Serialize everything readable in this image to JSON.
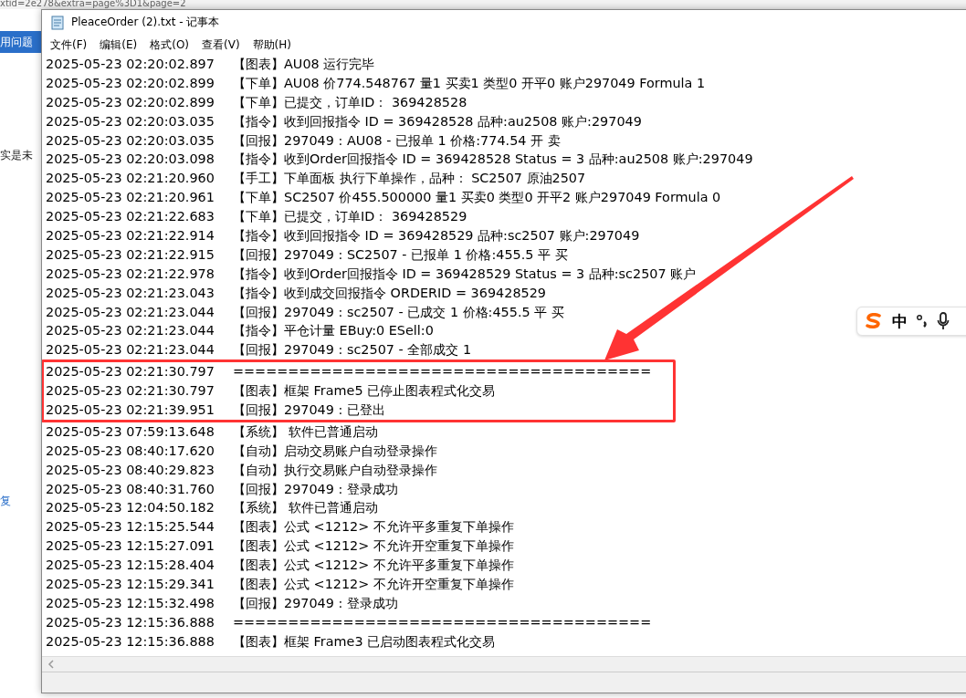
{
  "background": {
    "url": "xtid=2e278&extra=page%3D1&page=2",
    "tab": "用问题",
    "snippets": [
      "实是未",
      "复"
    ]
  },
  "window": {
    "title": "PleaceOrder (2).txt - 记事本"
  },
  "menu": [
    "文件(F)",
    "编辑(E)",
    "格式(O)",
    "查看(V)",
    "帮助(H)"
  ],
  "lines": [
    {
      "time": "2025-05-23 02:20:02.897",
      "message": "【图表】AU08 运行完毕",
      "highlighted": false
    },
    {
      "time": "2025-05-23 02:20:02.899",
      "message": "【下单】AU08 价774.548767 量1 买卖1 类型0 开平0 账户297049 Formula 1",
      "highlighted": false
    },
    {
      "time": "2025-05-23 02:20:02.899",
      "message": "【下单】已提交，订单ID： 369428528",
      "highlighted": false
    },
    {
      "time": "2025-05-23 02:20:03.035",
      "message": "【指令】收到回报指令 ID = 369428528 品种:au2508 账户:297049",
      "highlighted": false
    },
    {
      "time": "2025-05-23 02:20:03.035",
      "message": "【回报】297049 : AU08 - 已报单 1 价格:774.54 开 卖",
      "highlighted": false
    },
    {
      "time": "2025-05-23 02:20:03.098",
      "message": "【指令】收到Order回报指令 ID = 369428528 Status = 3 品种:au2508 账户:297049",
      "highlighted": false
    },
    {
      "time": "2025-05-23 02:21:20.960",
      "message": "【手工】下单面板 执行下单操作，品种： SC2507 原油2507",
      "highlighted": false
    },
    {
      "time": "2025-05-23 02:21:20.961",
      "message": "【下单】SC2507 价455.500000 量1 买卖0 类型0 开平2 账户297049 Formula 0",
      "highlighted": false
    },
    {
      "time": "2025-05-23 02:21:22.683",
      "message": "【下单】已提交，订单ID： 369428529",
      "highlighted": false
    },
    {
      "time": "2025-05-23 02:21:22.914",
      "message": "【指令】收到回报指令 ID = 369428529 品种:sc2507 账户:297049",
      "highlighted": false
    },
    {
      "time": "2025-05-23 02:21:22.915",
      "message": "【回报】297049 : SC2507 - 已报单 1 价格:455.5 平 买",
      "highlighted": false
    },
    {
      "time": "2025-05-23 02:21:22.978",
      "message": "【指令】收到Order回报指令 ID = 369428529 Status = 3 品种:sc2507 账户",
      "highlighted": false
    },
    {
      "time": "2025-05-23 02:21:23.043",
      "message": "【指令】收到成交回报指令 ORDERID = 369428529",
      "highlighted": false
    },
    {
      "time": "2025-05-23 02:21:23.044",
      "message": "【回报】297049 : sc2507 - 已成交 1 价格:455.5 平 买",
      "highlighted": false
    },
    {
      "time": "2025-05-23 02:21:23.044",
      "message": "【指令】平仓计量 EBuy:0 ESell:0",
      "highlighted": false
    },
    {
      "time": "2025-05-23 02:21:23.044",
      "message": "【回报】297049 : sc2507 - 全部成交 1",
      "highlighted": false
    },
    {
      "time": "2025-05-23 02:21:30.797",
      "message": "======================================",
      "highlighted": true
    },
    {
      "time": "2025-05-23 02:21:30.797",
      "message": "【图表】框架 Frame5 已停止图表程式化交易",
      "highlighted": true
    },
    {
      "time": "2025-05-23 02:21:39.951",
      "message": "【回报】297049 : 已登出",
      "highlighted": true
    },
    {
      "time": "2025-05-23 07:59:13.648",
      "message": "【系统】 软件已普通启动",
      "highlighted": false
    },
    {
      "time": "2025-05-23 08:40:17.620",
      "message": "【自动】启动交易账户自动登录操作",
      "highlighted": false
    },
    {
      "time": "2025-05-23 08:40:29.823",
      "message": "【自动】执行交易账户自动登录操作",
      "highlighted": false
    },
    {
      "time": "2025-05-23 08:40:31.760",
      "message": "【回报】297049 : 登录成功",
      "highlighted": false
    },
    {
      "time": "2025-05-23 12:04:50.182",
      "message": "【系统】 软件已普通启动",
      "highlighted": false
    },
    {
      "time": "2025-05-23 12:15:25.544",
      "message": "【图表】公式 <1212> 不允许平多重复下单操作",
      "highlighted": false
    },
    {
      "time": "2025-05-23 12:15:27.091",
      "message": "【图表】公式 <1212> 不允许开空重复下单操作",
      "highlighted": false
    },
    {
      "time": "2025-05-23 12:15:28.404",
      "message": "【图表】公式 <1212> 不允许平多重复下单操作",
      "highlighted": false
    },
    {
      "time": "2025-05-23 12:15:29.341",
      "message": "【图表】公式 <1212> 不允许开空重复下单操作",
      "highlighted": false
    },
    {
      "time": "2025-05-23 12:15:32.498",
      "message": "【回报】297049 : 登录成功",
      "highlighted": false
    },
    {
      "time": "2025-05-23 12:15:36.888",
      "message": "======================================",
      "highlighted": false
    },
    {
      "time": "2025-05-23 12:15:36.888",
      "message": "【图表】框架 Frame3 已启动图表程式化交易",
      "highlighted": false
    }
  ],
  "ime": {
    "mode": "中"
  }
}
